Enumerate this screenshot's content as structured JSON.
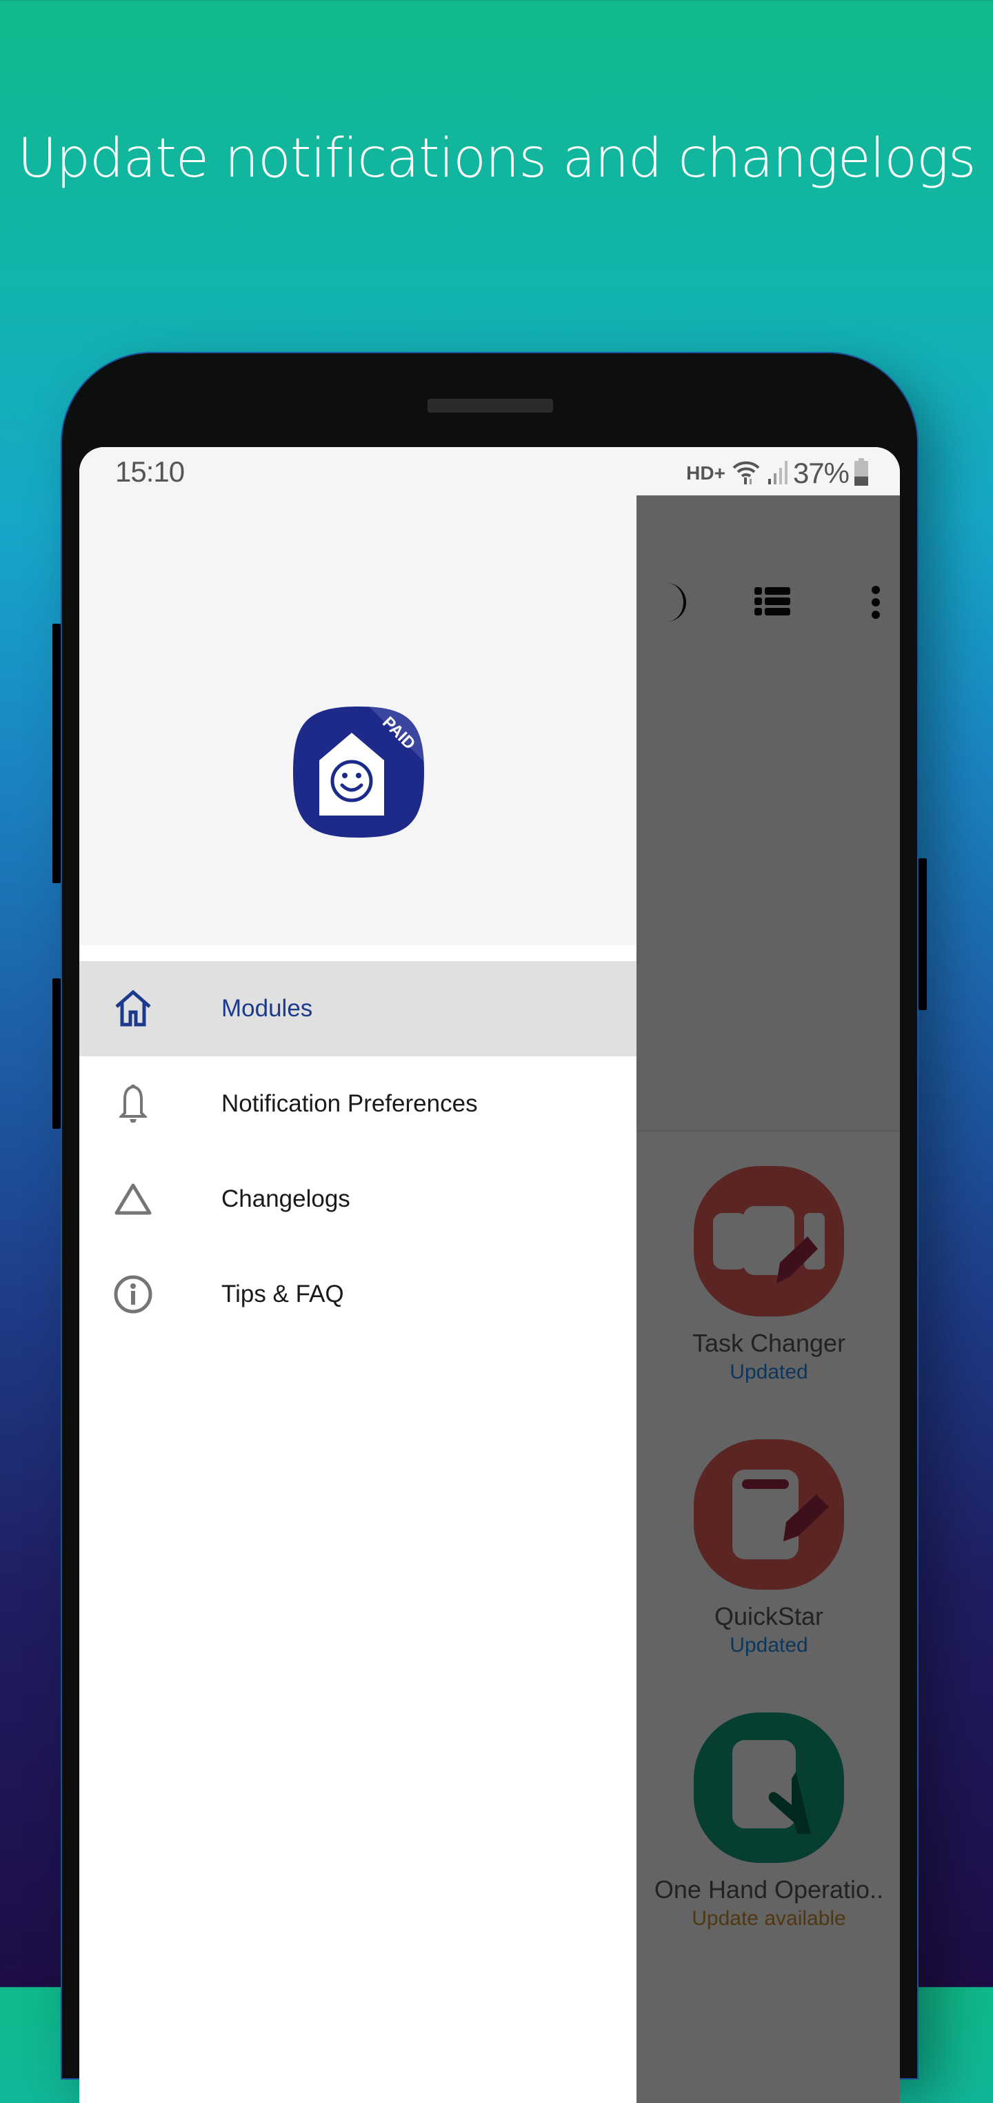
{
  "headline": "Update notifications and changelogs",
  "status_bar": {
    "time": "15:10",
    "network": "HD+",
    "battery_percent": "37%",
    "battery_level": 0.37
  },
  "drawer": {
    "logo": {
      "badge": "PAID",
      "icon": "home-smiley-icon",
      "color": "#1e2a8a"
    },
    "items": [
      {
        "label": "Modules",
        "icon": "home-icon",
        "active": true
      },
      {
        "label": "Notification Preferences",
        "icon": "bell-icon",
        "active": false
      },
      {
        "label": "Changelogs",
        "icon": "triangle-icon",
        "active": false
      },
      {
        "label": "Tips & FAQ",
        "icon": "info-icon",
        "active": false
      }
    ],
    "active_color": "#1c3a8c"
  },
  "toolbar": {
    "icons": [
      "moon-icon",
      "list-view-icon",
      "more-vert-icon"
    ]
  },
  "modules": [
    {
      "name": "Task Changer",
      "status": "Updated",
      "status_color": "#1e88e5",
      "icon_color": "#e35d5b"
    },
    {
      "name": "QuickStar",
      "status": "Updated",
      "status_color": "#1e88e5",
      "icon_color": "#e35d5b"
    },
    {
      "name": "One Hand Operatio..",
      "status": "Update available",
      "status_color": "#c88a2a",
      "icon_color": "#0f9b7d"
    }
  ]
}
